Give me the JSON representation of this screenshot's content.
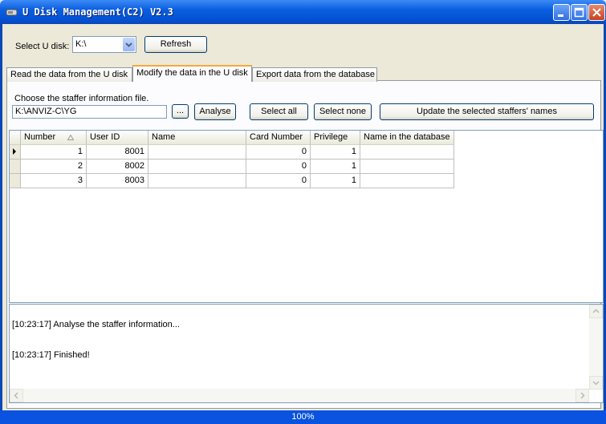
{
  "window": {
    "title": "U Disk Management(C2) V2.3"
  },
  "top": {
    "select_label": "Select U disk:",
    "drive_value": "K:\\",
    "refresh_label": "Refresh"
  },
  "tabs": [
    {
      "label": "Read the data from the U disk"
    },
    {
      "label": "Modify the data in the U disk"
    },
    {
      "label": "Export data from the database"
    }
  ],
  "panel": {
    "choose_label": "Choose the staffer information file.",
    "path_value": "K:\\ANVIZ-C\\YG",
    "browse_label": "...",
    "analyse_label": "Analyse",
    "select_all_label": "Select all",
    "select_none_label": "Select none",
    "update_label": "Update the selected staffers' names"
  },
  "grid": {
    "columns": [
      "Number",
      "User ID",
      "Name",
      "Card Number",
      "Privilege",
      "Name in the database"
    ],
    "rows": [
      [
        "1",
        "8001",
        "",
        "0",
        "1",
        ""
      ],
      [
        "2",
        "8002",
        "",
        "0",
        "1",
        ""
      ],
      [
        "3",
        "8003",
        "",
        "0",
        "1",
        ""
      ]
    ]
  },
  "log": {
    "lines": [
      "[10:23:17] Analyse the staffer information...",
      "[10:23:17] Finished!"
    ]
  },
  "status": {
    "progress_text": "100%",
    "progress_value": 1.0
  }
}
